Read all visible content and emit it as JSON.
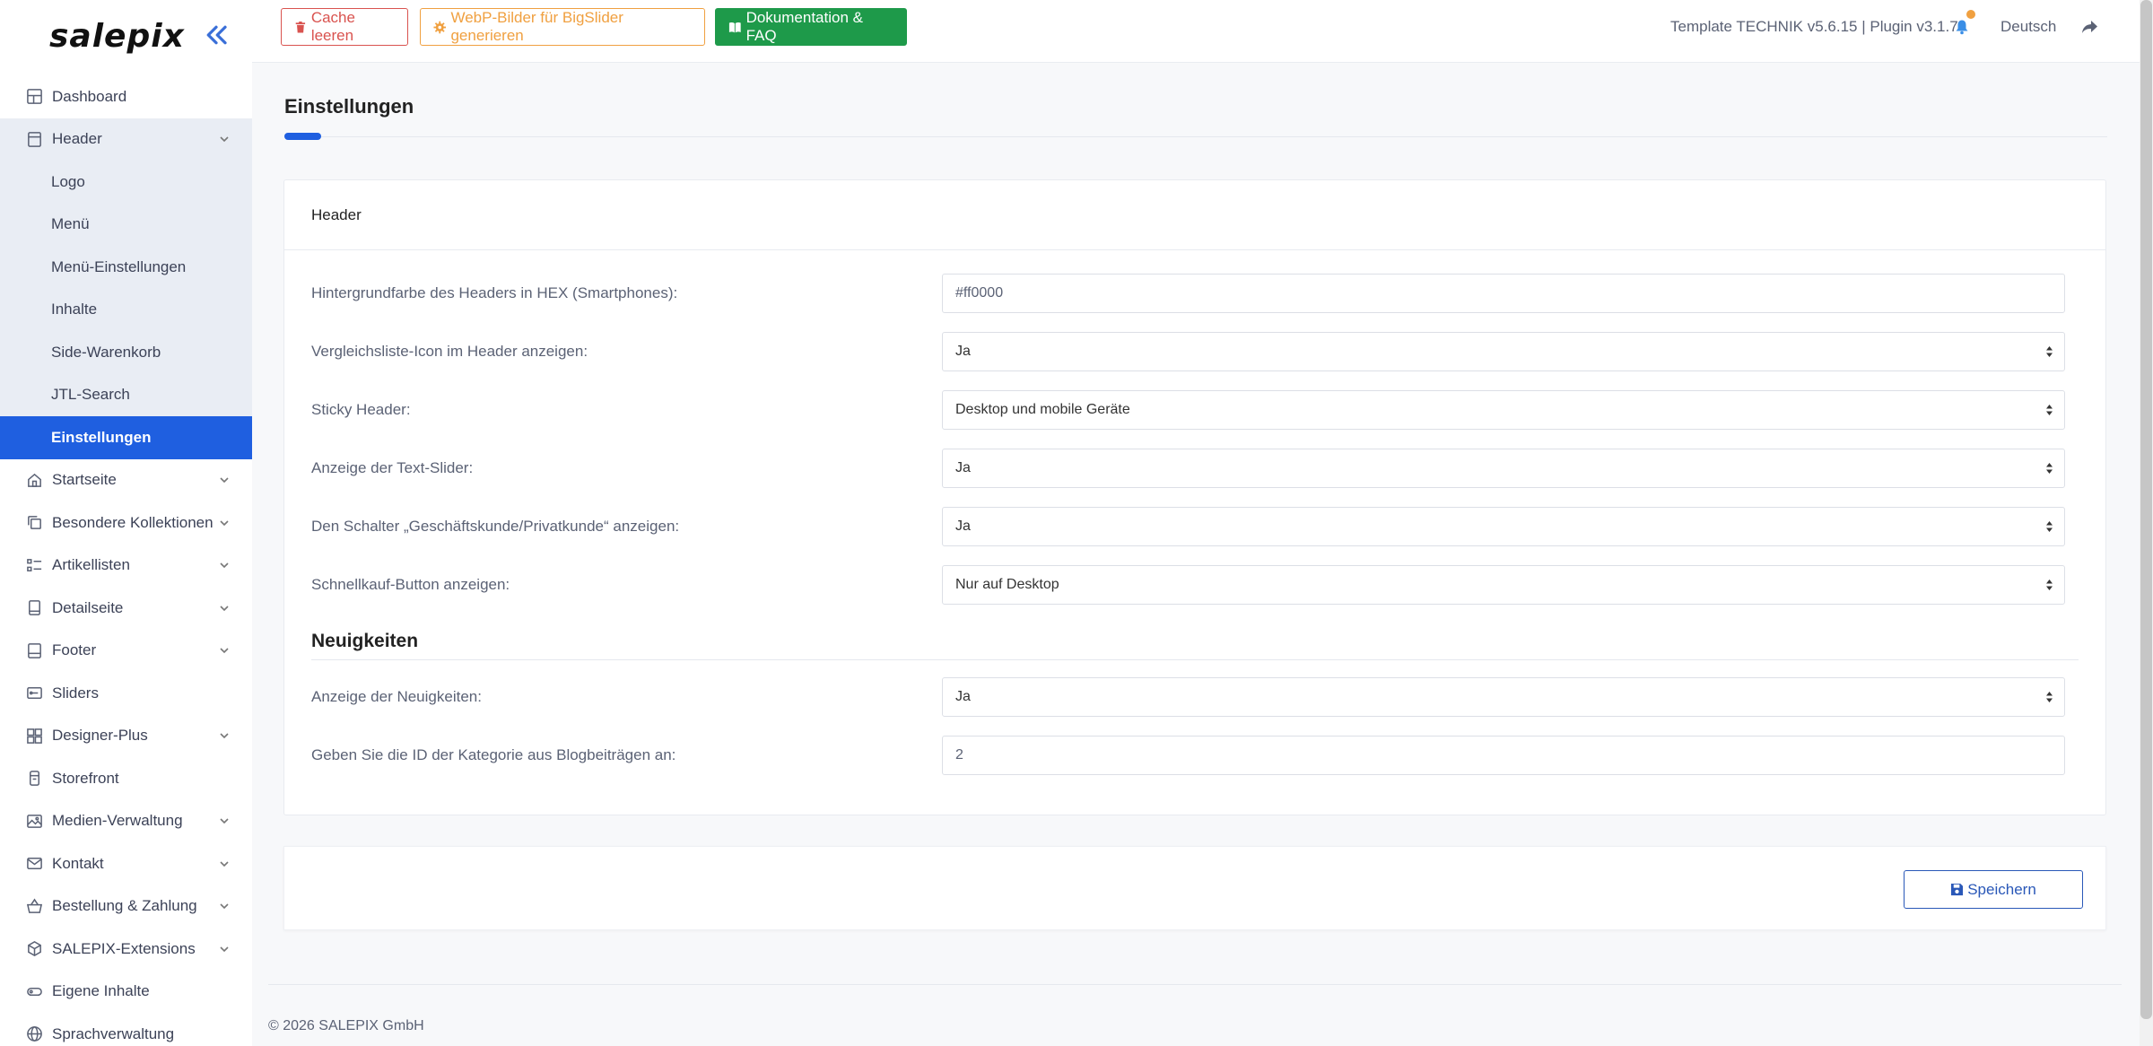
{
  "brand": {
    "name": "salepix"
  },
  "sidebar": {
    "items": [
      {
        "label": "Dashboard",
        "icon": "dashboard-icon",
        "has_children": false
      },
      {
        "label": "Header",
        "icon": "header-icon",
        "has_children": true,
        "expanded": true,
        "children": [
          {
            "label": "Logo"
          },
          {
            "label": "Menü"
          },
          {
            "label": "Menü-Einstellungen"
          },
          {
            "label": "Inhalte"
          },
          {
            "label": "Side-Warenkorb"
          },
          {
            "label": "JTL-Search"
          },
          {
            "label": "Einstellungen",
            "active": true
          }
        ]
      },
      {
        "label": "Startseite",
        "icon": "home-icon",
        "has_children": true
      },
      {
        "label": "Besondere Kollektionen",
        "icon": "collections-icon",
        "has_children": true
      },
      {
        "label": "Artikellisten",
        "icon": "list-icon",
        "has_children": true
      },
      {
        "label": "Detailseite",
        "icon": "tablet-icon",
        "has_children": true
      },
      {
        "label": "Footer",
        "icon": "footer-icon",
        "has_children": true
      },
      {
        "label": "Sliders",
        "icon": "slider-icon",
        "has_children": false
      },
      {
        "label": "Designer-Plus",
        "icon": "grid-icon",
        "has_children": true
      },
      {
        "label": "Storefront",
        "icon": "storefront-icon",
        "has_children": false
      },
      {
        "label": "Medien-Verwaltung",
        "icon": "image-icon",
        "has_children": true
      },
      {
        "label": "Kontakt",
        "icon": "mail-icon",
        "has_children": true
      },
      {
        "label": "Bestellung & Zahlung",
        "icon": "basket-icon",
        "has_children": true
      },
      {
        "label": "SALEPIX-Extensions",
        "icon": "cube-icon",
        "has_children": true
      },
      {
        "label": "Eigene Inhalte",
        "icon": "tag-icon",
        "has_children": false
      },
      {
        "label": "Sprachverwaltung",
        "icon": "globe-icon",
        "has_children": false
      }
    ]
  },
  "topbar": {
    "cache_label": "Cache leeren",
    "webp_label": "WebP-Bilder für BigSlider generieren",
    "doku_label": "Dokumentation & FAQ",
    "version": "Template TECHNIK v5.6.15 | Plugin v3.1.7",
    "language": "Deutsch"
  },
  "page": {
    "title": "Einstellungen"
  },
  "card": {
    "header": "Header",
    "fields": [
      {
        "label": "Hintergrundfarbe des Headers in HEX (Smartphones):",
        "type": "input",
        "value": "#ff0000"
      },
      {
        "label": "Vergleichsliste-Icon im Header anzeigen:",
        "type": "select",
        "value": "Ja"
      },
      {
        "label": "Sticky Header:",
        "type": "select",
        "value": "Desktop und mobile Geräte"
      },
      {
        "label": "Anzeige der Text-Slider:",
        "type": "select",
        "value": "Ja"
      },
      {
        "label": "Den Schalter „Geschäftskunde/Privatkunde“ anzeigen:",
        "type": "select",
        "value": "Ja"
      },
      {
        "label": "Schnellkauf-Button anzeigen:",
        "type": "select",
        "value": "Nur auf Desktop"
      }
    ],
    "section2_title": "Neuigkeiten",
    "fields2": [
      {
        "label": "Anzeige der Neuigkeiten:",
        "type": "select",
        "value": "Ja"
      },
      {
        "label": "Geben Sie die ID der Kategorie aus Blogbeiträgen an:",
        "type": "input",
        "value": "2"
      }
    ]
  },
  "save": {
    "label": "Speichern"
  },
  "footer": {
    "copyright": "© 2026 SALEPIX GmbH"
  },
  "colors": {
    "accent": "#1f5fe0",
    "danger": "#d9534f",
    "warning": "#f0a040",
    "success": "#1e9a4a"
  }
}
